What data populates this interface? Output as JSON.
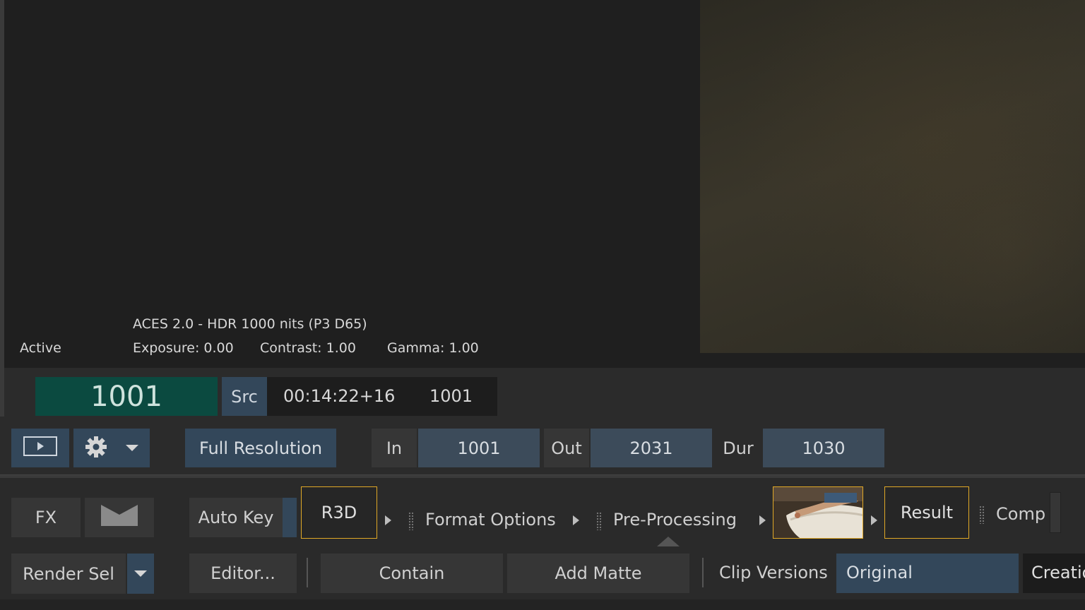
{
  "viewer": {
    "status": "Active",
    "color_space": "ACES 2.0 - HDR 1000 nits (P3 D65)",
    "exposure": "Exposure: 0.00",
    "contrast": "Contrast: 1.00",
    "gamma": "Gamma: 1.00"
  },
  "timecode": {
    "frame": "1001",
    "src_label": "Src",
    "timecode": "00:14:22+16",
    "src_frame": "1001"
  },
  "transport": {
    "resolution": "Full Resolution",
    "in_label": "In",
    "in_value": "1001",
    "out_label": "Out",
    "out_value": "2031",
    "dur_label": "Dur",
    "dur_value": "1030"
  },
  "pipeline": {
    "fx_label": "FX",
    "auto_key_label": "Auto Key",
    "r3d_label": "R3D",
    "format_options_label": "Format Options",
    "pre_processing_label": "Pre-Processing",
    "result_label": "Result",
    "comp_label": "Comp"
  },
  "bottom_row": {
    "render_sel_label": "Render Sel",
    "editor_label": "Editor...",
    "contain_label": "Contain",
    "add_matte_label": "Add Matte",
    "clip_versions_label": "Clip Versions",
    "clip_version_value": "Original",
    "creation_label": "Creatio"
  },
  "colors": {
    "frame_bg": "#0b4a40",
    "accent_blue": "#33475a",
    "node_border": "#e0a826"
  }
}
